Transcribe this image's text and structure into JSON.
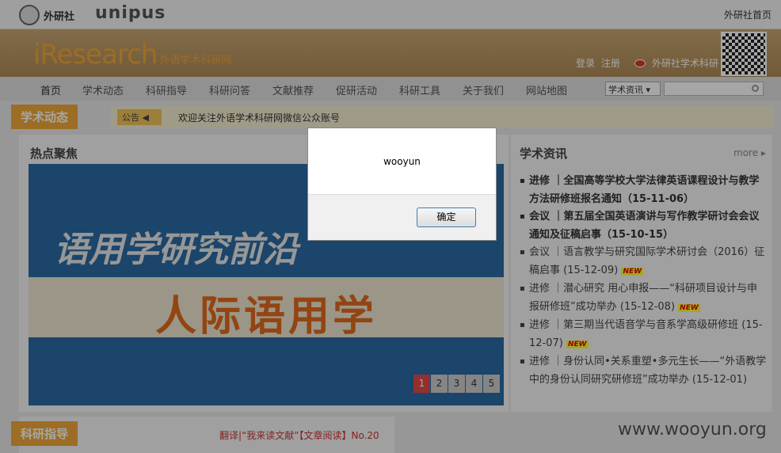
{
  "topbar": {
    "fltrp_logo": "外研社",
    "unipus_logo": "unipus",
    "home_link": "外研社首页"
  },
  "header": {
    "brand_main": "iResearch",
    "brand_sub": "外语学术科研网",
    "login": "登录",
    "register": "注册",
    "weibo_label": "外研社学术科研"
  },
  "nav": {
    "items": [
      "首页",
      "学术动态",
      "科研指导",
      "科研问答",
      "文献推荐",
      "促研活动",
      "科研工具",
      "关于我们",
      "网站地图"
    ],
    "select_value": "学术资讯"
  },
  "academic": {
    "tag": "学术动态",
    "notice_badge": "公告",
    "notice_text": "欢迎关注外语学术科研网微信公众账号"
  },
  "hot": {
    "title": "热点聚焦",
    "headline1": "语用学研究前沿",
    "headline2": "人际语用学",
    "pages": [
      "1",
      "2",
      "3",
      "4",
      "5"
    ]
  },
  "news": {
    "title": "学术资讯",
    "more": "more",
    "items": [
      {
        "text": "进修 ｜全国高等学校大学法律英语课程设计与教学方法研修班报名通知（15-11-06）",
        "bold": true,
        "new": false
      },
      {
        "text": "会议 ｜第五届全国英语演讲与写作教学研讨会会议通知及征稿启事（15-10-15）",
        "bold": true,
        "new": false
      },
      {
        "text": "会议 ｜语言教学与研究国际学术研讨会（2016）征稿启事 (15-12-09)",
        "bold": false,
        "new": true
      },
      {
        "text": "进修 ｜潜心研究 用心申报——“科研项目设计与申报研修班”成功举办 (15-12-08)",
        "bold": false,
        "new": true
      },
      {
        "text": "进修 ｜第三期当代语音学与音系学高级研修班 (15-12-07)",
        "bold": false,
        "new": true
      },
      {
        "text": "进修 ｜身份认同•关系重塑•多元生长——“外语教学中的身份认同研究研修班”成功举办 (15-12-01)",
        "bold": false,
        "new": false
      }
    ],
    "new_label": "NEW"
  },
  "guide": {
    "tag": "科研指导",
    "link": "翻译|“我来读文献”【文章阅读】No.20"
  },
  "watermark": "www.wooyun.org",
  "dialog": {
    "message": "wooyun",
    "ok": "确定"
  }
}
